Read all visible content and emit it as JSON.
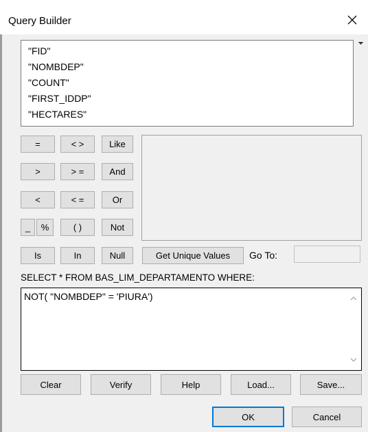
{
  "window": {
    "title": "Query Builder"
  },
  "fields": [
    "\"FID\"",
    "\"NOMBDEP\"",
    "\"COUNT\"",
    "\"FIRST_IDDP\"",
    "\"HECTARES\""
  ],
  "operators": {
    "eq": "=",
    "neq": "< >",
    "like": "Like",
    "gt": ">",
    "gte": "> =",
    "and": "And",
    "lt": "<",
    "lte": "< =",
    "or": "Or",
    "underscore": "_",
    "percent": "%",
    "parens": "( )",
    "not": "Not",
    "is": "Is",
    "in": "In",
    "null": "Null"
  },
  "unique_values_label": "Get Unique Values",
  "goto_label": "Go To:",
  "goto_value": "",
  "sql_prefix": "SELECT * FROM BAS_LIM_DEPARTAMENTO WHERE:",
  "sql_expression": "NOT( \"NOMBDEP\" = 'PIURA')",
  "actions": {
    "clear": "Clear",
    "verify": "Verify",
    "help": "Help",
    "load": "Load...",
    "save": "Save..."
  },
  "footer": {
    "ok": "OK",
    "cancel": "Cancel"
  }
}
